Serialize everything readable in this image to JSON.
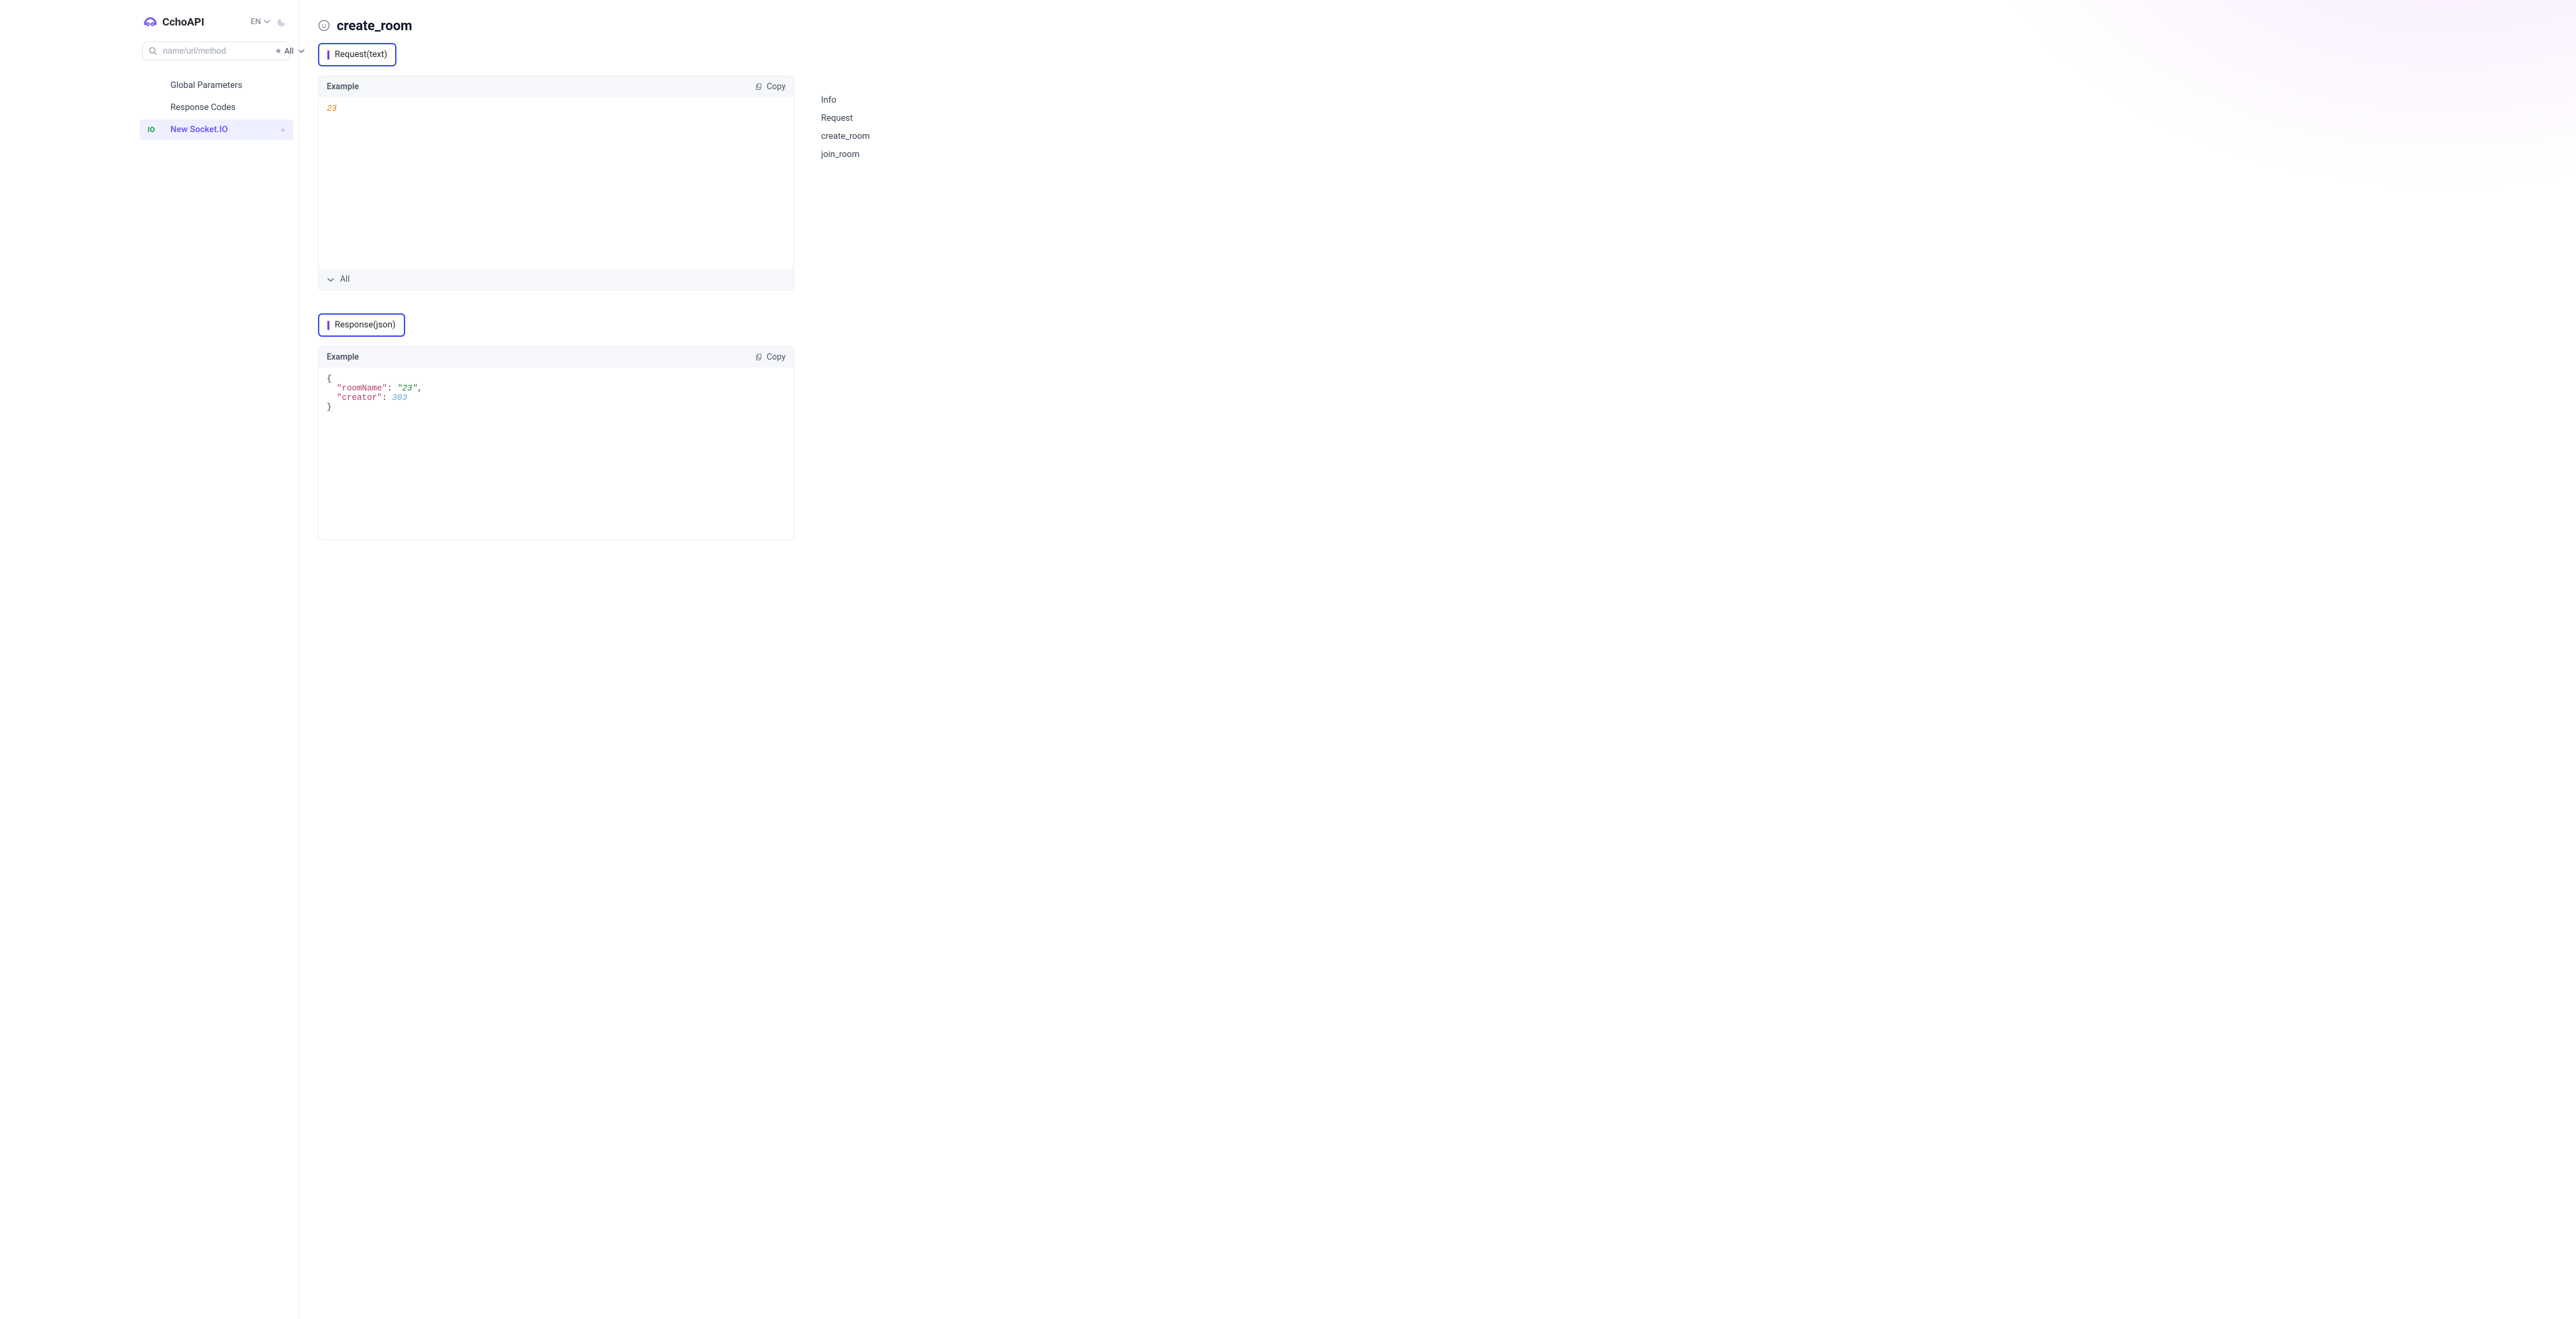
{
  "brand": {
    "name": "CchoAPI"
  },
  "header": {
    "lang": "EN"
  },
  "sidebar": {
    "search_placeholder": "name/url/method",
    "all_label": "All",
    "items": [
      {
        "label": "Global Parameters"
      },
      {
        "label": "Response Codes"
      },
      {
        "io": "IO",
        "label": "New Socket.IO",
        "active": true
      }
    ]
  },
  "operation": {
    "title": "create_room",
    "request_tab": "Request(text)",
    "response_tab": "Response(json)",
    "request_example_label": "Example",
    "response_example_label": "Example",
    "copy_label": "Copy",
    "all_toggle_label": "All",
    "request_body": {
      "value_text": "23"
    },
    "response_body": {
      "open_brace": "{",
      "line1_key": "\"roomName\"",
      "line1_colon": ": ",
      "line1_val": "\"23\"",
      "line1_comma": ",",
      "line2_key": "\"creator\"",
      "line2_colon": ": ",
      "line2_val": "303",
      "close_brace": "}"
    }
  },
  "outline": {
    "items": [
      "Info",
      "Request",
      "create_room",
      "join_room"
    ]
  }
}
